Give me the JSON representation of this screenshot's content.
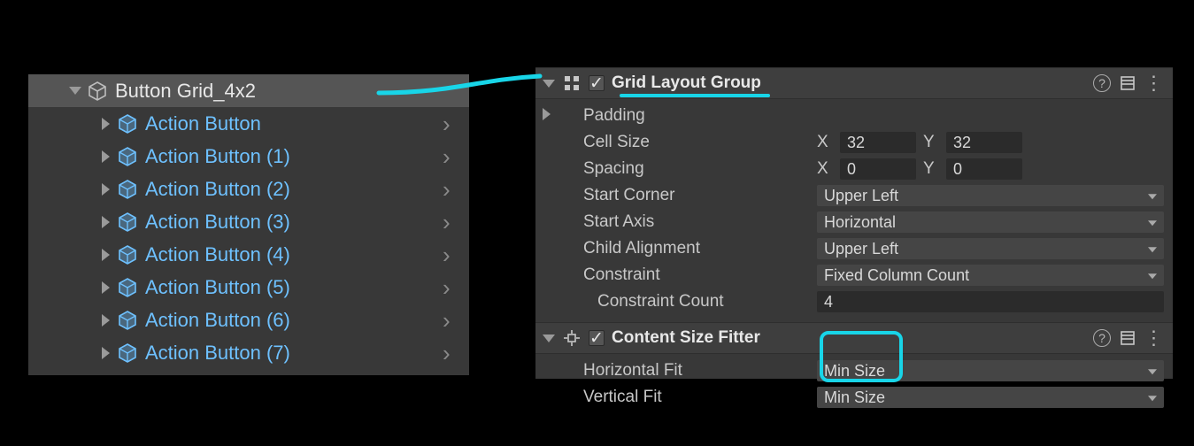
{
  "hierarchy": {
    "parent_label": "Button Grid_4x2",
    "children": [
      "Action Button",
      "Action Button (1)",
      "Action Button (2)",
      "Action Button (3)",
      "Action Button (4)",
      "Action Button (5)",
      "Action Button (6)",
      "Action Button (7)"
    ]
  },
  "inspector": {
    "comp1": {
      "title": "Grid Layout Group",
      "enabled_glyph": "✓",
      "padding_label": "Padding",
      "cell_size_label": "Cell Size",
      "cell_size_x_label": "X",
      "cell_size_x": "32",
      "cell_size_y_label": "Y",
      "cell_size_y": "32",
      "spacing_label": "Spacing",
      "spacing_x_label": "X",
      "spacing_x": "0",
      "spacing_y_label": "Y",
      "spacing_y": "0",
      "start_corner_label": "Start Corner",
      "start_corner": "Upper Left",
      "start_axis_label": "Start Axis",
      "start_axis": "Horizontal",
      "child_align_label": "Child Alignment",
      "child_align": "Upper Left",
      "constraint_label": "Constraint",
      "constraint": "Fixed Column Count",
      "constraint_count_label": "Constraint Count",
      "constraint_count": "4"
    },
    "comp2": {
      "title": "Content Size Fitter",
      "enabled_glyph": "✓",
      "hfit_label": "Horizontal Fit",
      "hfit": "Min Size",
      "vfit_label": "Vertical Fit",
      "vfit": "Min Size"
    },
    "icons": {
      "help": "?",
      "menu": "⋮"
    }
  },
  "colors": {
    "accent": "#18d5e8",
    "prefab": "#6ec1ff"
  }
}
